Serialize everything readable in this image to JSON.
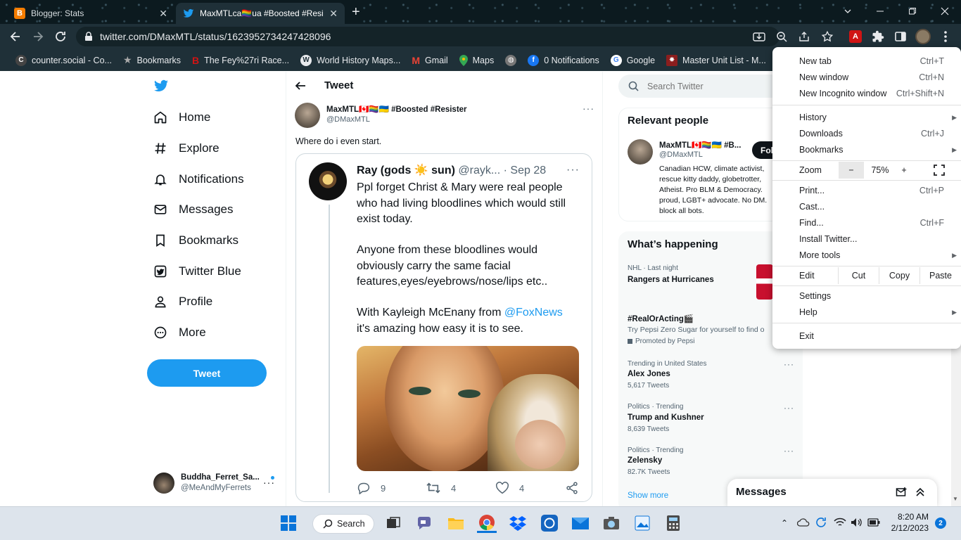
{
  "browser": {
    "tabs": [
      {
        "title": "Blogger: Stats",
        "active": false
      },
      {
        "title": "MaxMTLca🏳️‍🌈ua #Boosted #Resi",
        "active": true
      }
    ],
    "new_tab_symbol": "+",
    "url": "twitter.com/DMaxMTL/status/1623952734247428096",
    "bookmarks": [
      {
        "label": "counter.social - Co...",
        "icon": "counter-social-icon",
        "color": "#444"
      },
      {
        "label": "Bookmarks",
        "icon": "star-icon",
        "color": "#888"
      },
      {
        "label": "The Fey%27ri Race...",
        "icon": "b-icon",
        "color": "#d01414"
      },
      {
        "label": "World History Maps...",
        "icon": "wordpress-icon",
        "color": "#e8eaed"
      },
      {
        "label": "Gmail",
        "icon": "gmail-icon",
        "color": "#ea4335"
      },
      {
        "label": "Maps",
        "icon": "maps-icon",
        "color": "#34a853"
      },
      {
        "label": "",
        "icon": "globe-icon",
        "color": "#777"
      },
      {
        "label": "0 Notifications",
        "icon": "facebook-icon",
        "color": "#1877f2"
      },
      {
        "label": "Google",
        "icon": "google-icon",
        "color": "#fff"
      },
      {
        "label": "Master Unit List - M...",
        "icon": "mul-icon",
        "color": "#8b1e1e"
      }
    ]
  },
  "twitter": {
    "nav": [
      {
        "label": "Home",
        "icon": "home-icon"
      },
      {
        "label": "Explore",
        "icon": "hashtag-icon"
      },
      {
        "label": "Notifications",
        "icon": "bell-icon"
      },
      {
        "label": "Messages",
        "icon": "mail-icon"
      },
      {
        "label": "Bookmarks",
        "icon": "bookmark-icon"
      },
      {
        "label": "Twitter Blue",
        "icon": "twitter-blue-icon"
      },
      {
        "label": "Profile",
        "icon": "person-icon"
      },
      {
        "label": "More",
        "icon": "more-circle-icon"
      }
    ],
    "tweet_button": "Tweet",
    "account": {
      "name": "Buddha_Ferret_Sa...",
      "handle": "@MeAndMyFerrets"
    },
    "header": "Tweet",
    "tweet": {
      "author_name": "MaxMTL🇨🇦🏳️‍🌈🇺🇦 #Boosted #Resister",
      "author_handle": "@DMaxMTL",
      "text": "Where do i even start.",
      "quoted": {
        "name": "Ray (gods ☀️ sun)",
        "handle": "@rayk...",
        "date": "· Sep 28",
        "paragraphs": [
          "Ppl forget Christ & Mary were real people who had living bloodlines which would still exist today.",
          "Anyone from these bloodlines would obviously carry the same facial features,eyes/eyebrows/nose/lips etc..",
          "With Kayleigh McEnany from "
        ],
        "mention": "@FoxNews",
        "mention_tail": "it's amazing how easy it is to see.",
        "replies": "9",
        "retweets": "4",
        "likes": "4"
      }
    },
    "search_placeholder": "Search Twitter",
    "relevant": {
      "title": "Relevant people",
      "name": "MaxMTL🇨🇦🏳️‍🌈🇺🇦 #B...",
      "handle": "@DMaxMTL",
      "follow": "Fol",
      "bio": "Canadian HCW, climate activist, rescue kitty daddy, globetrotter, Atheist. Pro BLM & Democracy. proud, LGBT+ advocate. No DM. block all bots."
    },
    "happening": {
      "title": "What’s happening",
      "items": [
        {
          "context": "NHL · Last night",
          "title": "Rangers at Hurricanes",
          "count": ""
        },
        {
          "context": "",
          "title": "#RealOrActing🎬",
          "count": "Try Pepsi Zero Sugar for yourself to find o",
          "promoted": "Promoted by Pepsi"
        },
        {
          "context": "Trending in United States",
          "title": "Alex Jones",
          "count": "5,617 Tweets"
        },
        {
          "context": "Politics · Trending",
          "title": "Trump and Kushner",
          "count": "8,639 Tweets"
        },
        {
          "context": "Politics · Trending",
          "title": "Zelensky",
          "count": "82.7K Tweets"
        }
      ],
      "show_more": "Show more"
    },
    "messages_drawer": "Messages"
  },
  "menu": {
    "items": [
      {
        "label": "New tab",
        "shortcut": "Ctrl+T"
      },
      {
        "label": "New window",
        "shortcut": "Ctrl+N"
      },
      {
        "label": "New Incognito window",
        "shortcut": "Ctrl+Shift+N"
      },
      {
        "label": "History",
        "shortcut": ""
      },
      {
        "label": "Downloads",
        "shortcut": "Ctrl+J"
      },
      {
        "label": "Bookmarks",
        "shortcut": ""
      },
      {
        "label": "Print...",
        "shortcut": "Ctrl+P"
      },
      {
        "label": "Cast...",
        "shortcut": ""
      },
      {
        "label": "Find...",
        "shortcut": "Ctrl+F"
      },
      {
        "label": "Install Twitter...",
        "shortcut": ""
      },
      {
        "label": "More tools",
        "shortcut": ""
      },
      {
        "label": "Settings",
        "shortcut": ""
      },
      {
        "label": "Help",
        "shortcut": ""
      },
      {
        "label": "Exit",
        "shortcut": ""
      }
    ],
    "zoom": {
      "label": "Zoom",
      "minus": "−",
      "value": "75%",
      "plus": "+"
    },
    "edit": {
      "label": "Edit",
      "cut": "Cut",
      "copy": "Copy",
      "paste": "Paste"
    }
  },
  "taskbar": {
    "search": "Search",
    "time": "8:20 AM",
    "date": "2/12/2023",
    "notification_count": "2"
  }
}
